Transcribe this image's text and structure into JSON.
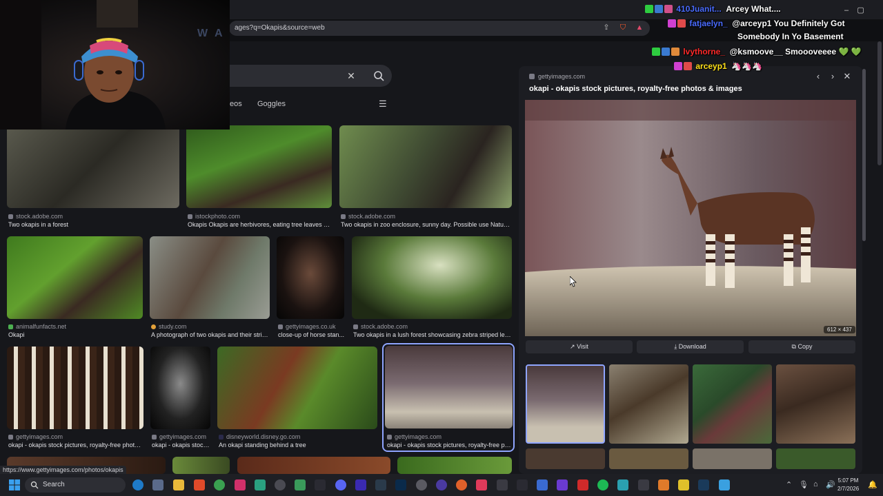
{
  "browser": {
    "url": "ages?q=Okapis&source=web",
    "window_controls": [
      "–",
      "▢",
      "✕"
    ]
  },
  "search": {
    "tabs": [
      "eos",
      "Goggles"
    ]
  },
  "webcam": {
    "overlay_text": "W A"
  },
  "results": [
    {
      "source": "stock.adobe.com",
      "caption": "Two okapis in a forest"
    },
    {
      "source": "istockphoto.com",
      "caption": "Okapis Okapis are herbivores, eating tree leaves and..."
    },
    {
      "source": "stock.adobe.com",
      "caption": "Two okapis in zoo enclosure, sunny day. Possible use Nature, ..."
    },
    {
      "source": "animalfunfacts.net",
      "caption": "Okapi"
    },
    {
      "source": "study.com",
      "caption": "A photograph of two okapis and their stripi..."
    },
    {
      "source": "gettyimages.co.uk",
      "caption": "close-up of horse stan..."
    },
    {
      "source": "stock.adobe.com",
      "caption": "Two okapis in a lush forest showcasing zebra striped legs ..."
    },
    {
      "source": "gettyimages.com",
      "caption": "okapi - okapis stock pictures, royalty-free photos..."
    },
    {
      "source": "gettyimages.com",
      "caption": "okapi - okapis stock..."
    },
    {
      "source": "disneyworld.disney.go.com",
      "caption": "An okapi standing behind a tree"
    },
    {
      "source": "gettyimages.com",
      "caption": "okapi - okapis stock pictures, royalty-free ph..."
    }
  ],
  "panel": {
    "source": "gettyimages.com",
    "title": "okapi - okapis stock pictures, royalty-free photos & images",
    "dimensions": "612 × 437",
    "buttons": {
      "visit": "Visit",
      "download": "Download",
      "copy": "Copy"
    }
  },
  "chat": [
    {
      "user": "410Juanit...",
      "message": "Arcey What....",
      "color": "#4a6cff"
    },
    {
      "user": "fatjaelyn_",
      "message": "@arceyp1 You Definitely Got",
      "message2": "Somebody In Yo Basement",
      "color": "#4a6cff"
    },
    {
      "user": "lvythorne_",
      "message": "@ksmoove__ Smoooveeee 💚 💚",
      "color": "#ff2a2a"
    },
    {
      "user": "arceyp1",
      "message": "🦄🦄🦄",
      "color": "#ffe11a"
    }
  ],
  "statusbar": {
    "url": "https://www.gettyimages.com/photos/okapis"
  },
  "taskbar": {
    "search_label": "Search",
    "time": "5:07 PM",
    "date": "2/7/2026"
  },
  "colors": {
    "accent": "#8fa5ff",
    "panel_bg": "#1c1d22",
    "page_bg": "#16171b"
  }
}
